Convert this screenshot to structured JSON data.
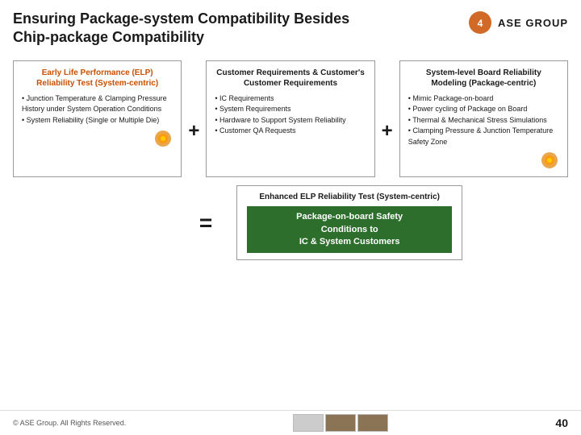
{
  "header": {
    "title_line1": "Ensuring Package-system Compatibility Besides",
    "title_line2": "Chip-package Compatibility",
    "logo_text": "ASE GROUP"
  },
  "box1": {
    "title": "Early Life Performance (ELP) Reliability Test (System-centric)",
    "items": [
      "Junction Temperature & Clamping Pressure History under System Operation Conditions",
      "System Reliability (Single or Multiple Die)"
    ]
  },
  "box2": {
    "title": "Customer Requirements & Customer's Customer Requirements",
    "items": [
      "IC Requirements",
      "System Requirements",
      "Hardware to Support System Reliability",
      "Customer QA Requests"
    ]
  },
  "box3": {
    "title": "System-level Board Reliability Modeling (Package-centric)",
    "items": [
      "Mimic Package-on-board",
      "Power cycling of Package on Board",
      "Thermal & Mechanical Stress Simulations",
      "Clamping Pressure & Junction Temperature Safety Zone"
    ]
  },
  "operators": {
    "plus": "+",
    "plus2": "+",
    "equals": "="
  },
  "result_box": {
    "title": "Enhanced ELP Reliability Test (System-centric)",
    "highlight_line1": "Package-on-board Safety",
    "highlight_line2": "Conditions to",
    "highlight_line3": "IC & System Customers"
  },
  "footer": {
    "copyright": "© ASE Group. All Rights Reserved.",
    "page_number": "40"
  }
}
